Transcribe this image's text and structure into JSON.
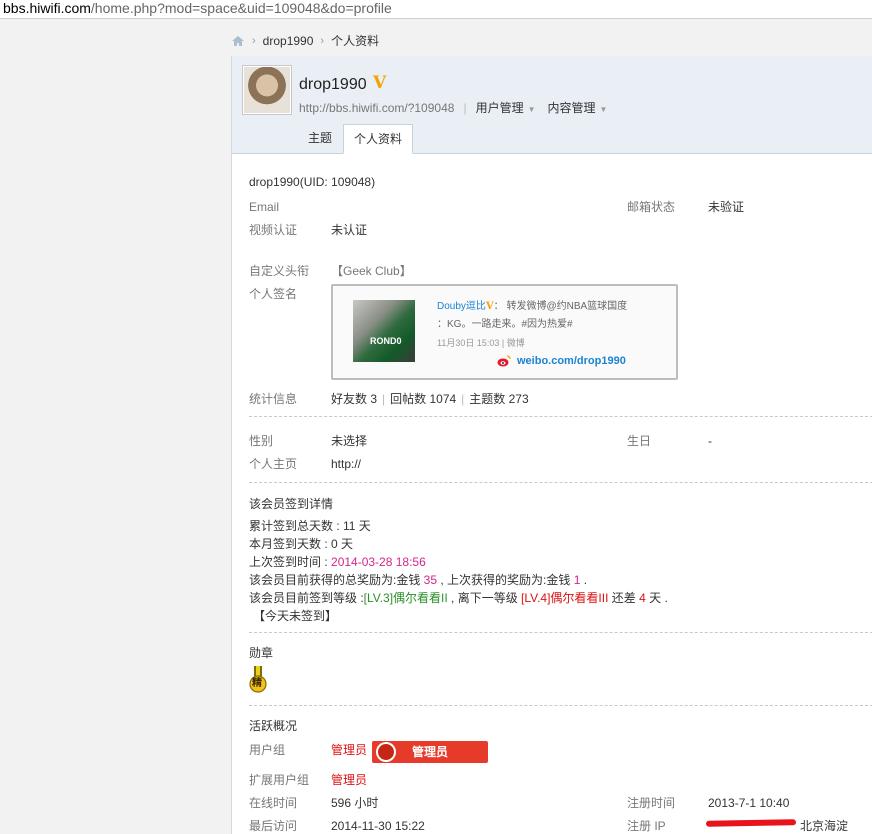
{
  "browser": {
    "url_host": "bbs.hiwifi.com",
    "url_path": "/home.php?mod=space&uid=109048&do=profile"
  },
  "breadcrumb": {
    "user": "drop1990",
    "page": "个人资料"
  },
  "header": {
    "username": "drop1990",
    "verified_badge": "V",
    "profile_url": "http://bbs.hiwifi.com/?109048",
    "menu_user": "用户管理",
    "menu_content": "内容管理",
    "tabs": [
      {
        "label": "主题",
        "active": false
      },
      {
        "label": "个人资料",
        "active": true
      }
    ]
  },
  "profile": {
    "title": "drop1990(UID: 109048)",
    "email_label": "Email",
    "email_status_label": "邮箱状态",
    "email_status_value": "未验证",
    "video_label": "视频认证",
    "video_value": "未认证",
    "custom_title_label": "自定义头衔",
    "custom_title_value": "【Geek Club】",
    "signature_label": "个人签名",
    "signature": {
      "author": "Douby逗比",
      "v": "V",
      "line1": "： 转发微博@约NBA篮球国度",
      "line2": "：KG。一路走来。#因为热爱#",
      "line3": "11月30日 15:03 | 微博",
      "jersey_number": "ROND0",
      "weibo_url": "weibo.com/drop1990"
    },
    "stats_label": "统计信息",
    "stats_friends": "好友数 3",
    "stats_replies": "回帖数 1074",
    "stats_topics": "主题数 273",
    "gender_label": "性别",
    "gender_value": "未选择",
    "birthday_label": "生日",
    "birthday_value": "-",
    "homepage_label": "个人主页",
    "homepage_value": "http://"
  },
  "checkin": {
    "heading": "该会员签到详情",
    "total_label": "累计签到总天数 : ",
    "total_value": "11 天",
    "month_label": "本月签到天数 : ",
    "month_value": "0 天",
    "last_label": "上次签到时间 : ",
    "last_value": "2014-03-28 18:56",
    "reward_prefix": "该会员目前获得的总奖励为:金钱 ",
    "reward_total": "35",
    "reward_mid": " , 上次获得的奖励为:金钱 ",
    "reward_last": "1",
    "reward_end": " .",
    "level_prefix": "该会员目前签到等级 :",
    "level_current": "[LV.3]偶尔看看II",
    "level_mid": " , 离下一等级 ",
    "level_next": "[LV.4]偶尔看看III",
    "level_gap_pre": " 还差 ",
    "level_gap": "4",
    "level_gap_post": " 天 .",
    "today": "【今天未签到】"
  },
  "medals": {
    "heading": "勋章",
    "medal_char": "精"
  },
  "activity": {
    "heading": "活跃概况",
    "group_label": "用户组",
    "group_value": "管理员",
    "group_badge": "管理员",
    "ext_group_label": "扩展用户组",
    "ext_group_value": "管理员",
    "online_label": "在线时间",
    "online_value": "596 小时",
    "reg_time_label": "注册时间",
    "reg_time_value": "2013-7-1 10:40",
    "last_visit_label": "最后访问",
    "last_visit_value": "2014-11-30 15:22",
    "reg_ip_label": "注册 IP",
    "reg_ip_tail": "北京海淀"
  },
  "colors": {
    "pink": "#d4268a",
    "green": "#2d8f2d",
    "red": "#dd1111",
    "link_blue": "#1a84d2",
    "badge_red": "#e63a2a",
    "header_bg": "#e9eff4"
  }
}
